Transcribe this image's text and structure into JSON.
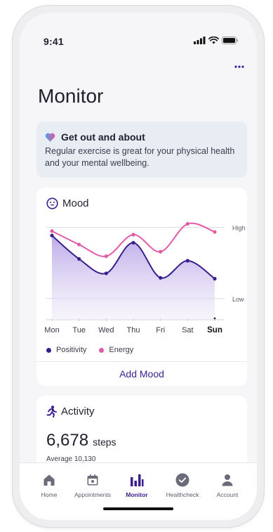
{
  "status_bar": {
    "time": "9:41"
  },
  "page": {
    "title": "Monitor"
  },
  "tip": {
    "title": "Get out and about",
    "body": "Regular exercise is great for your physical health and your mental wellbeing."
  },
  "mood": {
    "title": "Mood",
    "add_label": "Add Mood"
  },
  "chart_data": {
    "type": "line",
    "categories": [
      "Mon",
      "Tue",
      "Wed",
      "Thu",
      "Fri",
      "Sat",
      "Sun"
    ],
    "highlight_category": "Sun",
    "y_ticks": [
      "High",
      "Low"
    ],
    "series": [
      {
        "name": "Positivity",
        "color": "#3b1f8f",
        "values": [
          7.8,
          5.2,
          3.6,
          7.0,
          3.1,
          5.0,
          3.0
        ]
      },
      {
        "name": "Energy",
        "color": "#e35ba5",
        "values": [
          8.3,
          6.8,
          5.5,
          7.9,
          6.0,
          9.1,
          8.2
        ]
      }
    ],
    "ylim": [
      0,
      10
    ],
    "grid": true,
    "area_fill_series": "Positivity",
    "legend": "bottom-left"
  },
  "activity": {
    "title": "Activity",
    "steps_value": "6,678",
    "steps_unit": "steps",
    "average": "Average 10,130"
  },
  "tabs": [
    {
      "label": "Home",
      "icon": "home-icon",
      "active": false
    },
    {
      "label": "Appointments",
      "icon": "calendar-icon",
      "active": false
    },
    {
      "label": "Monitor",
      "icon": "bar-chart-icon",
      "active": true
    },
    {
      "label": "Healthcheck",
      "icon": "check-circle-icon",
      "active": false
    },
    {
      "label": "Account",
      "icon": "person-icon",
      "active": false
    }
  ],
  "colors": {
    "accent": "#3b1f8f",
    "energy": "#e35ba5",
    "tip_background": "#e8edf4"
  }
}
